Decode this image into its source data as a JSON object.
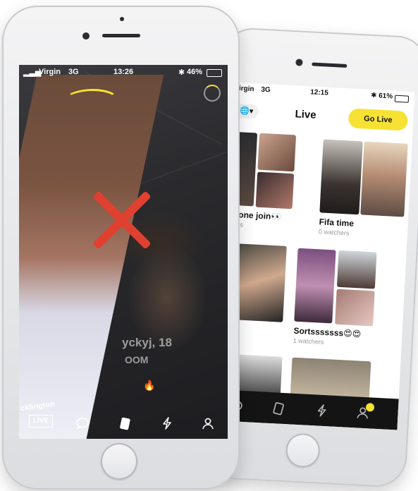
{
  "back_phone": {
    "status": {
      "carrier": "Virgin",
      "network": "3G",
      "time": "12:15",
      "battery": "61%"
    },
    "header": {
      "region_icon": "globe-icon",
      "title": "Live",
      "go_live_label": "Go Live"
    },
    "streams": [
      {
        "title": "meone join👀",
        "watchers": "tchers"
      },
      {
        "title": "Fifa time",
        "watchers": "0 watchers"
      },
      {
        "title": "",
        "watchers": "hers"
      },
      {
        "title": "Sortsssssss😍😍",
        "watchers": "1 watchers"
      }
    ],
    "tabbar": {
      "icons": [
        "chat-icon",
        "cards-icon",
        "flash-icon",
        "profile-icon"
      ],
      "accent": "#f7e234"
    }
  },
  "front_phone": {
    "status": {
      "carrier": "Virgin",
      "network": "3G",
      "time": "13:26",
      "battery": "46%"
    },
    "overlay": {
      "name": "yckyj, 18",
      "subtitle": "OOM",
      "badge_text": "cklington"
    },
    "reject_color": "#e0402f",
    "tabbar": {
      "live_label": "LIVE",
      "icons": [
        "chat-icon",
        "cards-icon",
        "flash-icon",
        "profile-icon"
      ]
    }
  }
}
